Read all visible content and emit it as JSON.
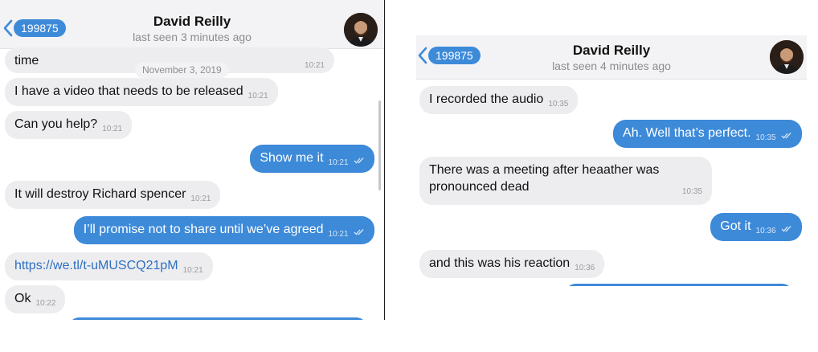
{
  "left": {
    "back_label": "199875",
    "title": "David Reilly",
    "status": "last seen 3 minutes ago",
    "date_chip": "November 3, 2019",
    "messages": [
      {
        "text": "time",
        "time": "10:21"
      },
      {
        "text": "I have a video that needs to be released",
        "time": "10:21"
      },
      {
        "text": "Can you help?",
        "time": "10:21"
      },
      {
        "text": "Show me it",
        "time": "10:21"
      },
      {
        "text": "It will destroy Richard spencer",
        "time": "10:21"
      },
      {
        "text": "I’ll promise not to share until we’ve agreed",
        "time": "10:21"
      },
      {
        "text": "https://we.tl/t-uMUSCQ21pM",
        "time": "10:21"
      },
      {
        "text": "Ok",
        "time": "10:22"
      }
    ]
  },
  "right": {
    "back_label": "199875",
    "title": "David Reilly",
    "status": "last seen 4 minutes ago",
    "messages": [
      {
        "text": "I recorded the audio",
        "time": "10:35"
      },
      {
        "text": "Ah. Well that’s perfect.",
        "time": "10:35"
      },
      {
        "text_line1": "There was a meeting after heaather was",
        "text_line2": "pronounced dead",
        "time": "10:35"
      },
      {
        "text": "Got it",
        "time": "10:36"
      },
      {
        "text": "and this was his reaction",
        "time": "10:36"
      }
    ]
  },
  "colors": {
    "accent": "#3d8ad9",
    "incoming_bubble": "#ededf0",
    "header_bg": "#f3f3f5"
  },
  "icons": [
    "chevron-left-icon",
    "double-check-icon",
    "avatar"
  ]
}
